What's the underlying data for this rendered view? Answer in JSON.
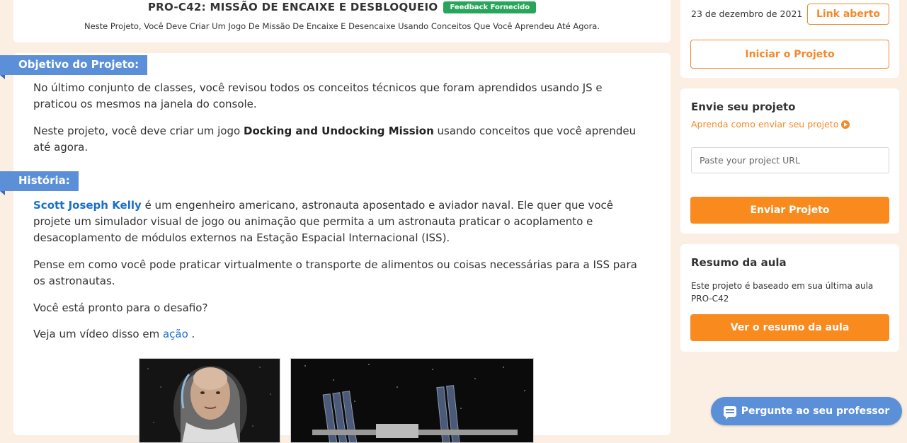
{
  "header": {
    "title": "PRO-C42: MISSÃO DE ENCAIXE E DESBLOQUEIO",
    "badge": "Feedback Fornecido",
    "subtitle": "Neste Projeto, Você Deve Criar Um Jogo De Missão De Encaixe E Desencaixe Usando Conceitos Que Você Aprendeu Até Agora."
  },
  "objective": {
    "tag": "Objetivo do Projeto:",
    "p1": "No último conjunto de classes, você revisou todos os conceitos técnicos que foram aprendidos usando JS e praticou os mesmos na janela do console.",
    "p2_before": "Neste projeto, você deve criar um jogo ",
    "p2_bold": "Docking and Undocking Mission",
    "p2_after": " usando conceitos que você aprendeu até agora."
  },
  "story": {
    "tag": "História:",
    "p1_link": "Scott Joseph Kelly",
    "p1_rest": " é um engenheiro americano, astronauta aposentado e aviador naval. Ele quer que você projete um simulador visual de jogo ou animação que permita a um astronauta praticar o acoplamento e desacoplamento de módulos externos na Estação Espacial Internacional (ISS).",
    "p2": "Pense em como você pode praticar virtualmente o transporte de alimentos ou coisas necessárias para a ISS para os astronautas.",
    "p3": "Você está pronto para o desafio?",
    "p4_before": "Veja um vídeo disso em ",
    "p4_link": "ação",
    "p4_after": " ."
  },
  "sidebar": {
    "date": "23 de dezembro de 2021",
    "link_button": "Link aberto",
    "start_button": "Iniciar o Projeto",
    "submit": {
      "heading": "Envie seu projeto",
      "help_link": "Aprenda como enviar seu projeto",
      "url_placeholder": "Paste your project URL",
      "submit_button": "Enviar Projeto"
    },
    "summary": {
      "heading": "Resumo da aula",
      "text": "Este projeto é baseado em sua última aula PRO-C42",
      "button": "Ver o resumo da aula"
    }
  },
  "ask_teacher": "Pergunte ao seu professor",
  "colors": {
    "accent_orange": "#f98a1e",
    "tag_blue": "#5b8fd8",
    "badge_green": "#27a65a",
    "link_blue": "#1a6fc9"
  }
}
